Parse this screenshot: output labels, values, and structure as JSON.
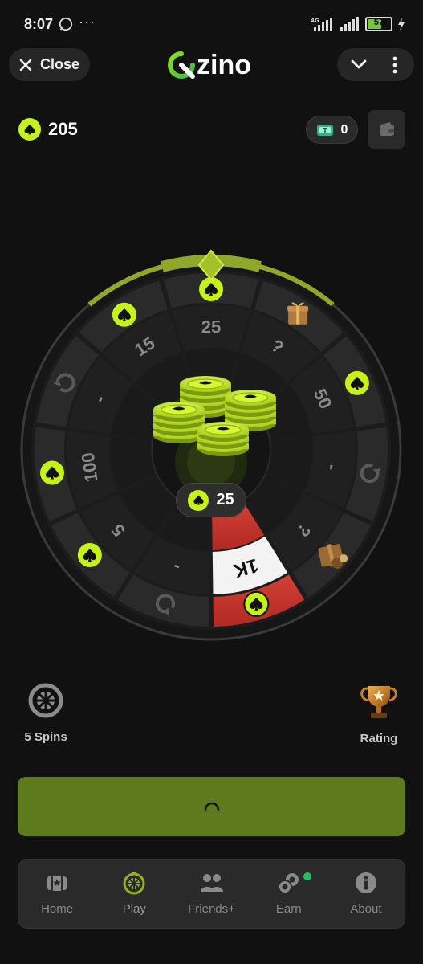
{
  "status_bar": {
    "time": "8:07",
    "dots": "···",
    "network": "4G",
    "battery": "57"
  },
  "header": {
    "close_label": "Close",
    "logo_text": "zino",
    "logo_full": "Qzino"
  },
  "balance": {
    "points": "205",
    "ton": "0"
  },
  "wheel": {
    "outer_segments": [
      "spade",
      "gift",
      "spade",
      "retry",
      "gift-box",
      "spade",
      "retry",
      "spade",
      "spade",
      "retry",
      "spade"
    ],
    "inner_labels": [
      "25",
      "?",
      "50",
      "-",
      "?",
      "1K",
      "-",
      "5",
      "100",
      "-",
      "15"
    ],
    "highlighted_prize": "1K",
    "current_bet": "25"
  },
  "spins": {
    "label": "5 Spins"
  },
  "rating": {
    "label": "Rating"
  },
  "nav": {
    "items": [
      {
        "label": "Home",
        "icon": "home-icon"
      },
      {
        "label": "Play",
        "icon": "wheel-icon"
      },
      {
        "label": "Friends+",
        "icon": "friends-icon"
      },
      {
        "label": "Earn",
        "icon": "coins-icon"
      },
      {
        "label": "About",
        "icon": "info-icon"
      }
    ]
  },
  "colors": {
    "accent": "#c6f21a",
    "spin_button": "#5d7b1c",
    "highlight_red": "#c0372e",
    "notification": "#1fc15c"
  }
}
